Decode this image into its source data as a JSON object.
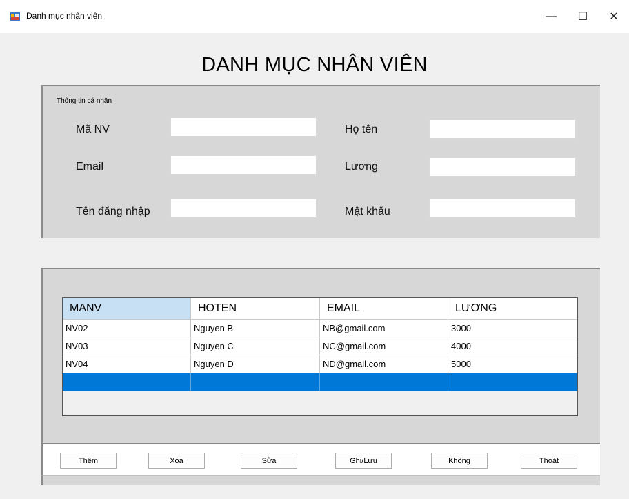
{
  "window": {
    "title": "Danh mục nhân viên",
    "controls": {
      "minimize": "—",
      "maximize": "☐",
      "close": "✕"
    }
  },
  "form": {
    "heading": "DANH MỤC NHÂN VIÊN",
    "info_group": {
      "title": "Thông tin cá nhân",
      "fields": {
        "manv": {
          "label": "Mã NV",
          "value": ""
        },
        "hoten": {
          "label": "Họ tên",
          "value": ""
        },
        "email": {
          "label": "Email",
          "value": ""
        },
        "luong": {
          "label": "Lương",
          "value": ""
        },
        "tendangnhap": {
          "label": "Tên đăng nhập",
          "value": ""
        },
        "matkhau": {
          "label": "Mật khẩu",
          "value": ""
        }
      }
    },
    "grid": {
      "columns": [
        "MANV",
        "HOTEN",
        "EMAIL",
        "LƯƠNG"
      ],
      "rows": [
        [
          "NV02",
          "Nguyen B",
          "NB@gmail.com",
          "3000"
        ],
        [
          "NV03",
          "Nguyen C",
          "NC@gmail.com",
          "4000"
        ],
        [
          "NV04",
          "Nguyen D",
          "ND@gmail.com",
          "5000"
        ]
      ]
    },
    "buttons": {
      "them": "Thêm",
      "xoa": "Xóa",
      "sua": "Sửa",
      "ghiluu": "Ghi/Lưu",
      "khong": "Không",
      "thoat": "Thoát"
    }
  },
  "colors": {
    "selection": "#0078d7",
    "header_selected": "#c7e0f4",
    "panel": "#d7d7d7"
  }
}
